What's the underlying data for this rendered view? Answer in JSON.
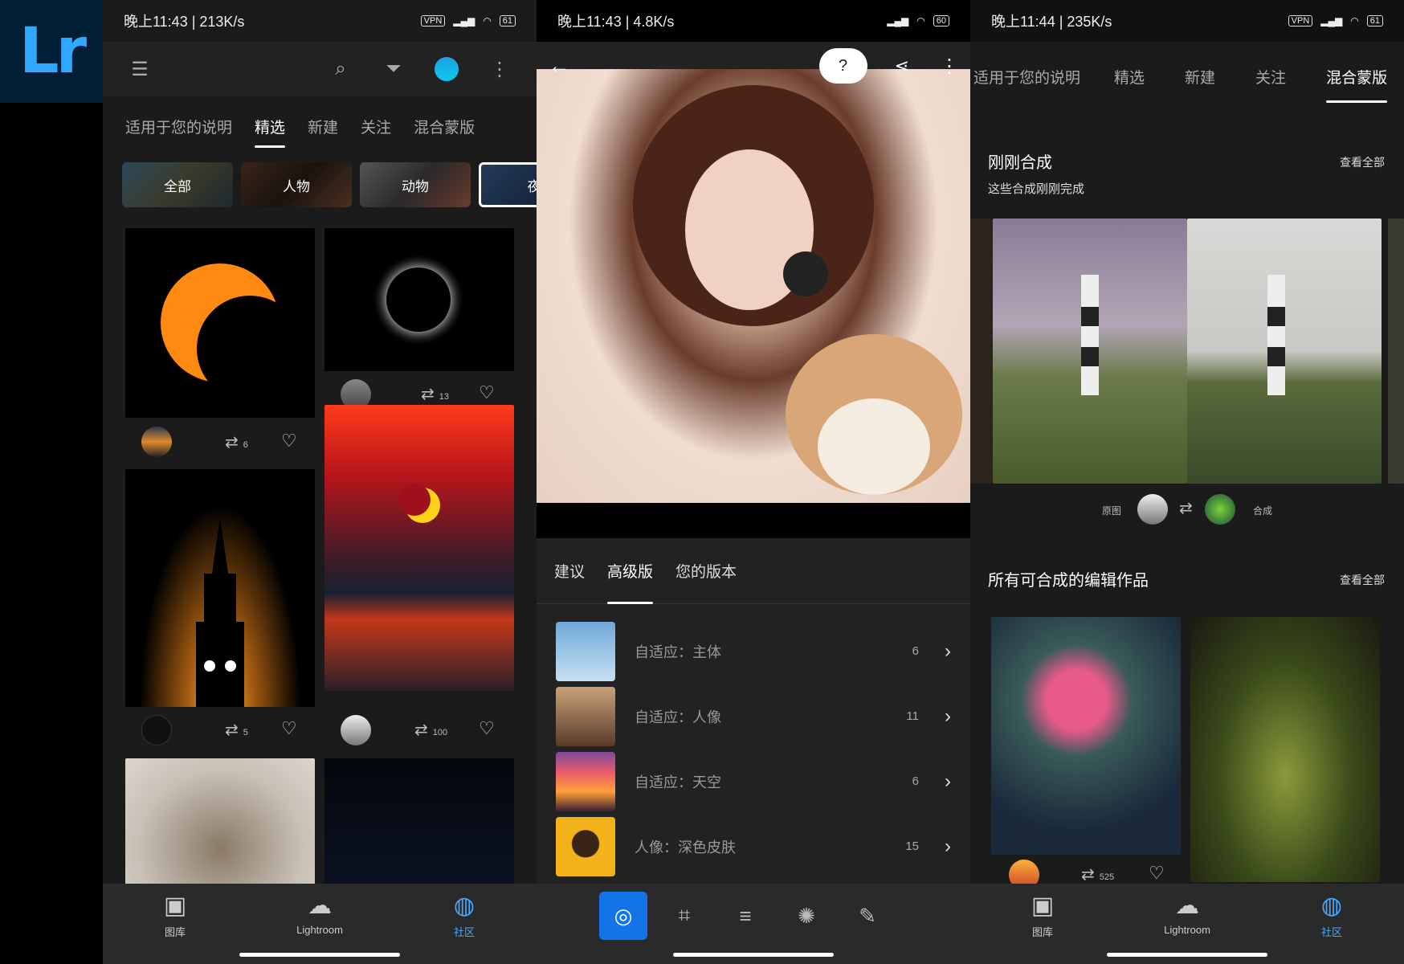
{
  "logo": {
    "text": "Lr"
  },
  "panel1": {
    "status": {
      "time": "晚上11:43 | 213K/s",
      "vpn": "VPN",
      "battery": "61"
    },
    "toolbar": {
      "menu_icon": "hamburger-icon",
      "search_icon": "search-icon",
      "filter_icon": "filter-icon",
      "more_icon": "more-vertical-icon"
    },
    "tabs": [
      "适用于您的说明",
      "精选",
      "新建",
      "关注",
      "混合蒙版"
    ],
    "active_tab": 1,
    "chips": [
      "全部",
      "人物",
      "动物",
      "夜"
    ],
    "cards": [
      {
        "remixes": "6"
      },
      {
        "remixes": "13"
      },
      {
        "remixes": "5"
      },
      {
        "remixes": "100"
      }
    ],
    "nav": [
      "图库",
      "Lightroom",
      "社区"
    ]
  },
  "panel2": {
    "status": {
      "time": "晚上11:43 | 4.8K/s",
      "battery": "60"
    },
    "bar": {
      "back_icon": "arrow-left-icon",
      "help_icon": "help-circle-icon",
      "share_icon": "share-icon",
      "more_icon": "more-vertical-icon"
    },
    "tabs": [
      "建议",
      "高级版",
      "您的版本"
    ],
    "active_tab": 1,
    "presets": [
      {
        "label": "自适应：主体",
        "count": "6"
      },
      {
        "label": "自适应：人像",
        "count": "11"
      },
      {
        "label": "自适应：天空",
        "count": "6"
      },
      {
        "label": "人像：深色皮肤",
        "count": "15"
      }
    ],
    "edit_tools": [
      "presets-icon",
      "crop-icon",
      "sliders-icon",
      "mask-icon",
      "healing-icon"
    ]
  },
  "panel3": {
    "status": {
      "time": "晚上11:44 | 235K/s",
      "vpn": "VPN",
      "battery": "61"
    },
    "tabs": [
      "适用于您的说明",
      "精选",
      "新建",
      "关注",
      "混合蒙版"
    ],
    "active_tab": 4,
    "section1": {
      "title": "刚刚合成",
      "subtitle": "这些合成刚刚完成",
      "see_all": "查看全部",
      "original_label": "原图",
      "remix_label": "合成"
    },
    "section2": {
      "title": "所有可合成的编辑作品",
      "see_all": "查看全部",
      "remixes": "525"
    },
    "nav": [
      "图库",
      "Lightroom",
      "社区"
    ]
  }
}
